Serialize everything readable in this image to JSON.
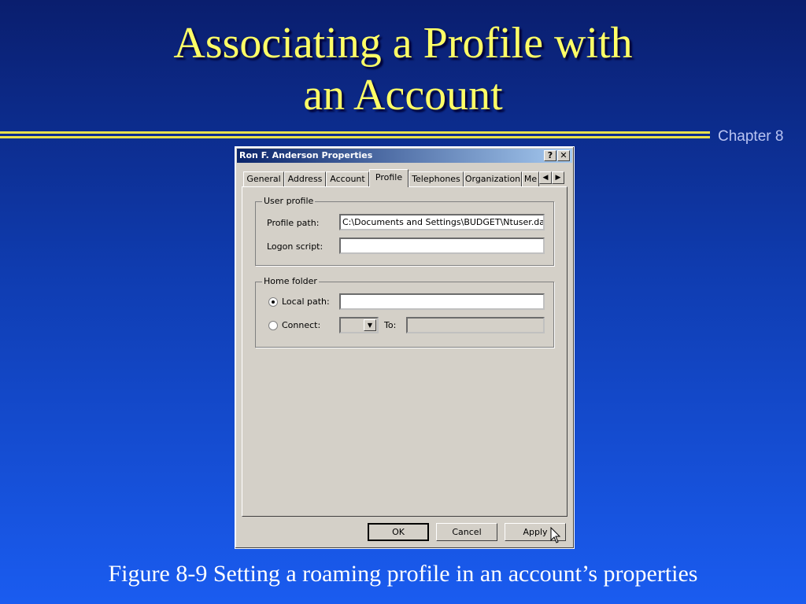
{
  "slide": {
    "title_line1": "Associating a Profile with",
    "title_line2": "an Account",
    "chapter": "Chapter 8",
    "caption": "Figure 8-9  Setting a roaming profile in an account’s properties"
  },
  "dialog": {
    "title": "Ron F. Anderson Properties",
    "help_glyph": "?",
    "close_glyph": "✕",
    "tabs": [
      "General",
      "Address",
      "Account",
      "Profile",
      "Telephones",
      "Organization",
      "Me"
    ],
    "active_tab": "Profile",
    "user_profile": {
      "group_label": "User profile",
      "profile_path_label": "Profile path:",
      "profile_path_value": "C:\\Documents and Settings\\BUDGET\\Ntuser.dat",
      "logon_script_label": "Logon script:",
      "logon_script_value": ""
    },
    "home_folder": {
      "group_label": "Home folder",
      "local_path_label": "Local path:",
      "local_path_selected": true,
      "local_path_value": "",
      "connect_label": "Connect:",
      "to_label": "To:",
      "to_value": ""
    },
    "buttons": {
      "ok": "OK",
      "cancel": "Cancel",
      "apply": "Apply"
    }
  }
}
